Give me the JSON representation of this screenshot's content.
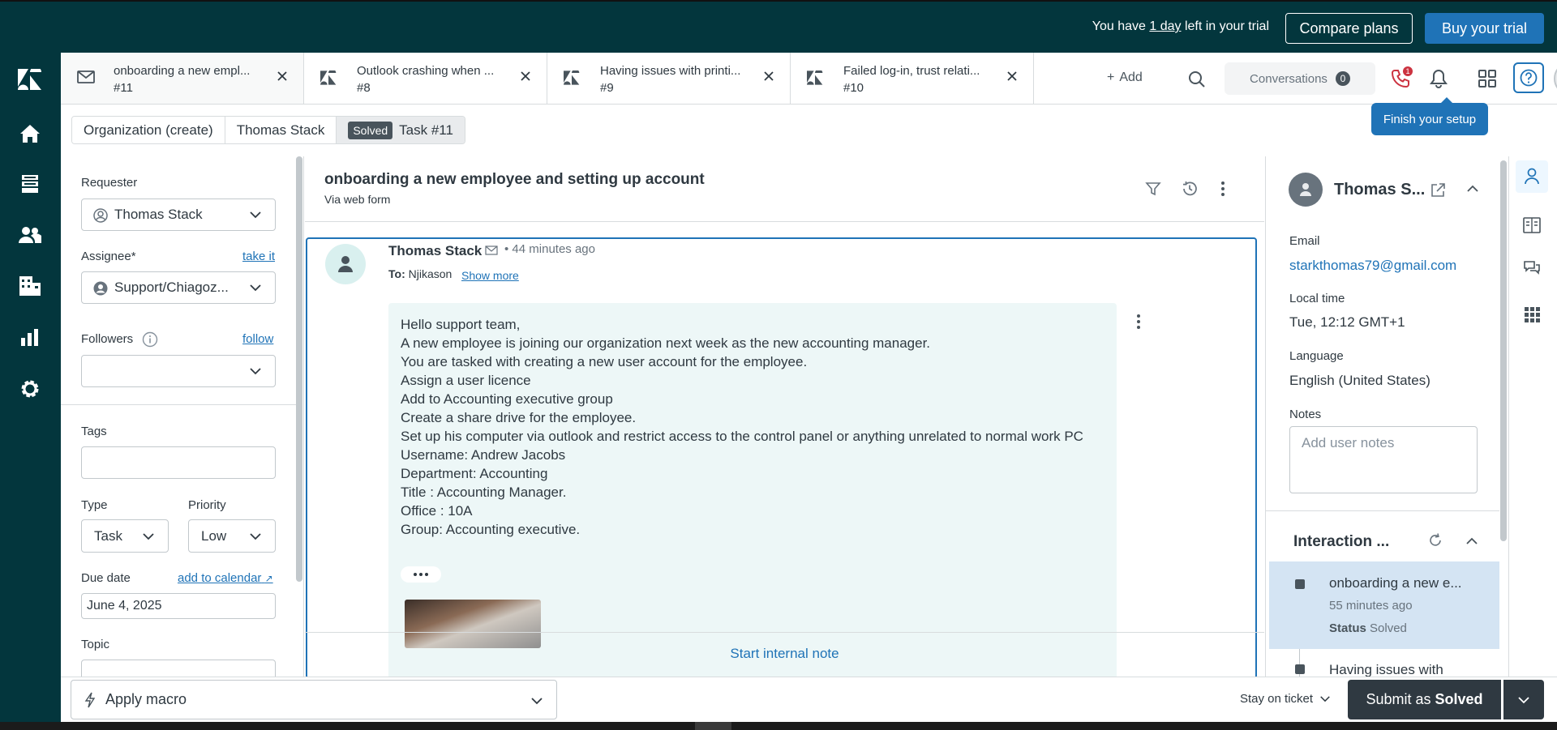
{
  "trial": {
    "prefix": "You have ",
    "days": "1 day",
    "suffix": " left in your trial",
    "compare_label": "Compare plans",
    "buy_label": "Buy your trial"
  },
  "leftnav": {
    "items": [
      "zendesk-logo-icon",
      "home-icon",
      "views-icon",
      "customers-icon",
      "organizations-icon",
      "reporting-icon",
      "admin-gear-icon"
    ]
  },
  "tabs": [
    {
      "title": "onboarding a new empl...",
      "number": "#11",
      "icon": "mail-icon"
    },
    {
      "title": "Outlook crashing when ...",
      "number": "#8",
      "icon": "zendesk-ticket-icon"
    },
    {
      "title": "Having issues with printi...",
      "number": "#9",
      "icon": "zendesk-ticket-icon"
    },
    {
      "title": "Failed log-in, trust relati...",
      "number": "#10",
      "icon": "zendesk-ticket-icon"
    }
  ],
  "toolbar": {
    "add_label": "Add",
    "conversations_label": "Conversations",
    "conversations_count": "0",
    "phone_badge": "1",
    "setup_tooltip": "Finish your setup"
  },
  "breadcrumb": {
    "org": "Organization (create)",
    "user": "Thomas Stack",
    "status": "Solved",
    "task": "Task #11"
  },
  "properties": {
    "requester_label": "Requester",
    "requester_value": "Thomas Stack",
    "assignee_label": "Assignee*",
    "assignee_link": "take it",
    "assignee_value": "Support/Chiagoz...",
    "followers_label": "Followers",
    "followers_link": "follow",
    "tags_label": "Tags",
    "type_label": "Type",
    "type_value": "Task",
    "priority_label": "Priority",
    "priority_value": "Low",
    "due_label": "Due date",
    "due_link": "add to calendar",
    "due_value": "June 4, 2025",
    "topic_label": "Topic"
  },
  "conversation": {
    "title": "onboarding a new employee and setting up account",
    "subtitle": "Via web form",
    "message": {
      "author": "Thomas Stack",
      "time": "44 minutes ago",
      "to_label": "To:",
      "to_value": "Njikason",
      "show_more": "Show more",
      "lines": [
        "Hello support team,",
        "A new employee is joining our organization next week as the new accounting manager.",
        "You are tasked with creating a new user account for the employee.",
        "Assign a user licence",
        "Add to Accounting executive group",
        "Create a share drive for the employee.",
        "Set up his computer via outlook and restrict access to the control panel or anything unrelated to normal work PC",
        "Username: Andrew Jacobs",
        "Department: Accounting",
        "Title : Accounting Manager.",
        "Office : 10A",
        "Group: Accounting executive."
      ]
    },
    "start_note": "Start internal note"
  },
  "user_panel": {
    "name": "Thomas S...",
    "email_label": "Email",
    "email_value": "starkthomas79@gmail.com",
    "localtime_label": "Local time",
    "localtime_value": "Tue, 12:12 GMT+1",
    "language_label": "Language",
    "language_value": "English (United States)",
    "notes_label": "Notes",
    "notes_placeholder": "Add user notes",
    "interaction_title": "Interaction ...",
    "interactions": [
      {
        "title": "onboarding a new e...",
        "time": "55 minutes ago",
        "status_label": "Status",
        "status_value": "Solved"
      },
      {
        "title": "Having issues with"
      }
    ]
  },
  "bottom": {
    "macro_label": "Apply macro",
    "stay_label": "Stay on ticket",
    "submit_prefix": "Submit as",
    "submit_status": "Solved"
  },
  "colors": {
    "nav_bg": "#03363d",
    "accent": "#1f73b7",
    "submit_bg": "#2f3941",
    "message_bg": "#edf7f7",
    "interaction_highlight": "#d4e4f3"
  }
}
